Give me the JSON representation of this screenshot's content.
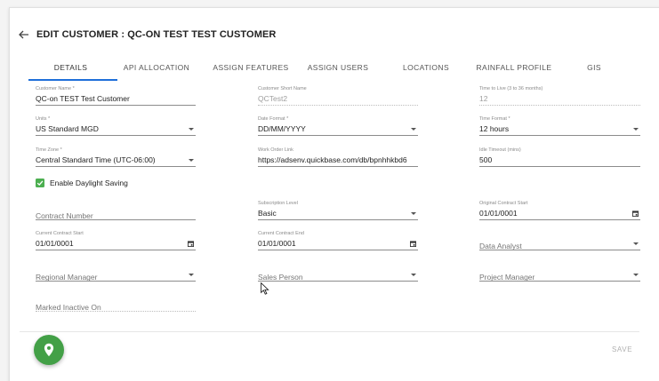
{
  "header": {
    "title": "EDIT CUSTOMER : QC-ON TEST TEST CUSTOMER"
  },
  "tabs": [
    {
      "label": "DETAILS",
      "active": true
    },
    {
      "label": "API ALLOCATION"
    },
    {
      "label": "ASSIGN FEATURES"
    },
    {
      "label": "ASSIGN USERS"
    },
    {
      "label": "LOCATIONS"
    },
    {
      "label": "RAINFALL PROFILE"
    },
    {
      "label": "GIS"
    }
  ],
  "form": {
    "customer_name": {
      "label": "Customer Name *",
      "value": "QC-on TEST Test Customer"
    },
    "customer_short_name": {
      "label": "Customer Short Name",
      "value": "QCTest2"
    },
    "time_to_live": {
      "label": "Time to Live (3 to 36 months)",
      "value": "12"
    },
    "units": {
      "label": "Units *",
      "value": "US Standard MGD"
    },
    "date_format": {
      "label": "Date Format *",
      "value": "DD/MM/YYYY"
    },
    "time_format": {
      "label": "Time Format *",
      "value": "12 hours"
    },
    "time_zone": {
      "label": "Time Zone *",
      "value": "Central Standard Time (UTC-06:00)"
    },
    "work_order_link": {
      "label": "Work Order Link",
      "value": "https://adsenv.quickbase.com/db/bpnhhkbd6"
    },
    "idle_timeout": {
      "label": "Idle Timeout (mins)",
      "value": "500"
    },
    "daylight_saving": {
      "label": "Enable Daylight Saving",
      "checked": true
    },
    "contract_number": {
      "placeholder": "Contract Number"
    },
    "subscription_level": {
      "label": "Subscription Level",
      "value": "Basic"
    },
    "original_contract_start": {
      "label": "Original Contract Start",
      "value": "01/01/0001"
    },
    "current_contract_start": {
      "label": "Current Contract Start",
      "value": "01/01/0001"
    },
    "current_contract_end": {
      "label": "Current Contract End",
      "value": "01/01/0001"
    },
    "data_analyst": {
      "placeholder": "Data Analyst"
    },
    "regional_manager": {
      "placeholder": "Regional Manager"
    },
    "sales_person": {
      "placeholder": "Sales Person"
    },
    "project_manager": {
      "placeholder": "Project Manager"
    },
    "marked_inactive_on": {
      "placeholder": "Marked Inactive On"
    }
  },
  "footer": {
    "save_label": "SAVE",
    "fab_icon": "map-pin-icon"
  },
  "colors": {
    "accent": "#1e6fd9",
    "fab": "#43a047",
    "checkbox": "#4caf50"
  }
}
